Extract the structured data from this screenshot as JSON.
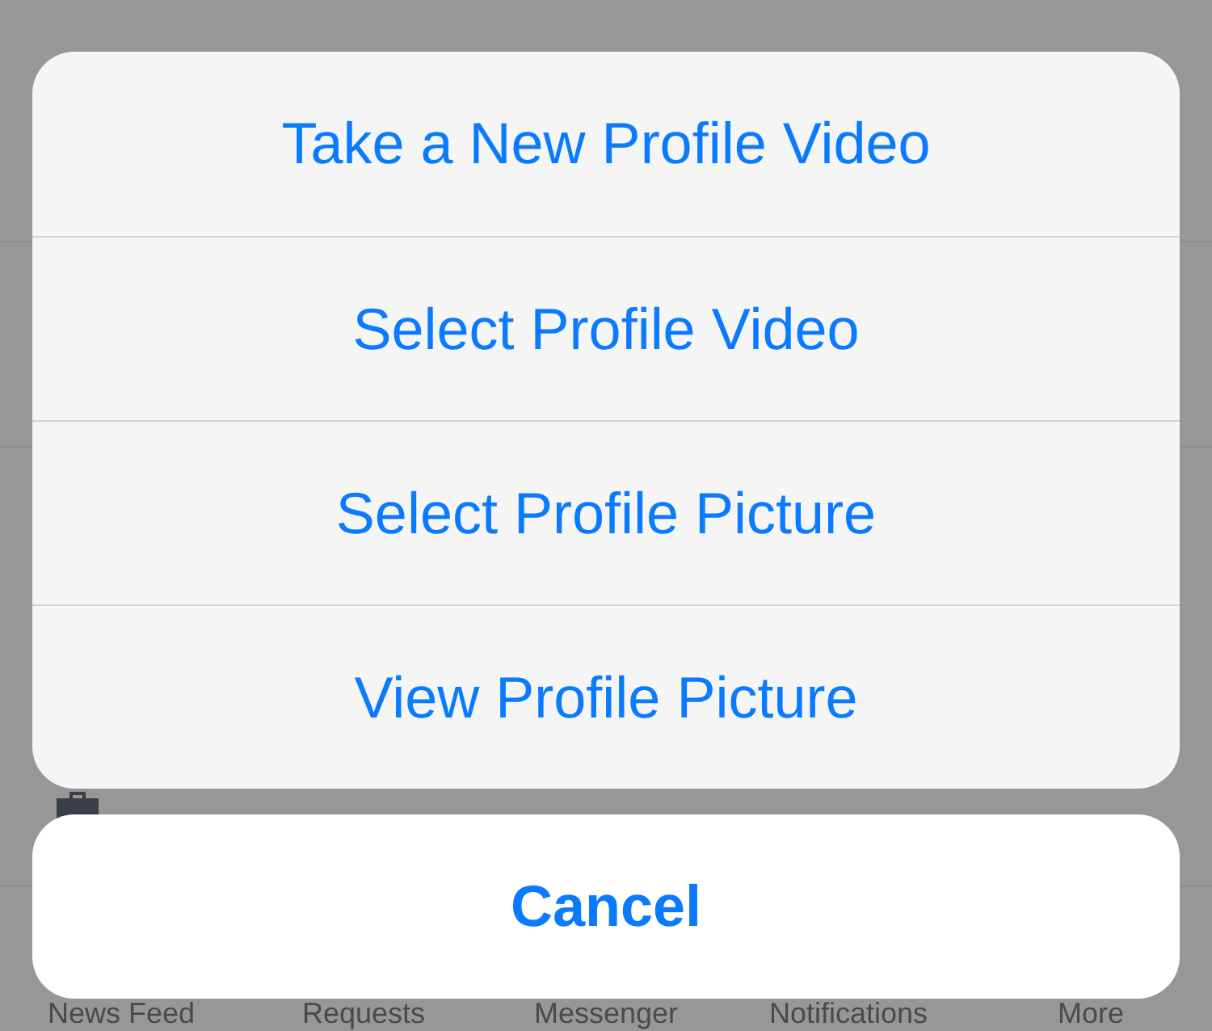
{
  "background": {
    "tab_bar": [
      {
        "label": "News Feed"
      },
      {
        "label": "Requests"
      },
      {
        "label": "Messenger"
      },
      {
        "label": "Notifications"
      },
      {
        "label": "More"
      }
    ]
  },
  "action_sheet": {
    "actions": [
      {
        "label": "Take a New Profile Video"
      },
      {
        "label": "Select Profile Video"
      },
      {
        "label": "Select Profile Picture"
      },
      {
        "label": "View Profile Picture"
      }
    ],
    "cancel": "Cancel"
  }
}
